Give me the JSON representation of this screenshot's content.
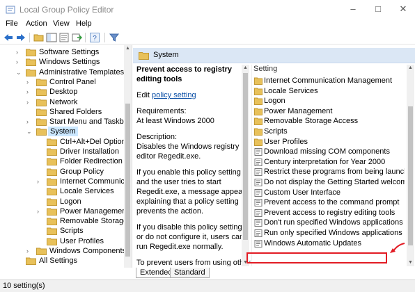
{
  "window": {
    "title": "Local Group Policy Editor"
  },
  "menu": [
    "File",
    "Action",
    "View",
    "Help"
  ],
  "tree": {
    "items": [
      {
        "label": "Software Settings",
        "expander": ">"
      },
      {
        "label": "Windows Settings",
        "expander": ">"
      },
      {
        "label": "Administrative Templates",
        "expander": "v"
      },
      {
        "label": "Control Panel",
        "expander": ">"
      },
      {
        "label": "Desktop",
        "expander": ">"
      },
      {
        "label": "Network",
        "expander": ">"
      },
      {
        "label": "Shared Folders",
        "expander": ""
      },
      {
        "label": "Start Menu and Taskbar",
        "expander": ">"
      },
      {
        "label": "System",
        "expander": "v",
        "selected": true
      },
      {
        "label": "Ctrl+Alt+Del Options",
        "expander": ""
      },
      {
        "label": "Driver Installation",
        "expander": ""
      },
      {
        "label": "Folder Redirection",
        "expander": ""
      },
      {
        "label": "Group Policy",
        "expander": ""
      },
      {
        "label": "Internet Communicat",
        "expander": ">"
      },
      {
        "label": "Locale Services",
        "expander": ""
      },
      {
        "label": "Logon",
        "expander": ""
      },
      {
        "label": "Power Management",
        "expander": ">"
      },
      {
        "label": "Removable Storage A",
        "expander": ""
      },
      {
        "label": "Scripts",
        "expander": ""
      },
      {
        "label": "User Profiles",
        "expander": ""
      },
      {
        "label": "Windows Components",
        "expander": ">"
      },
      {
        "label": "All Settings",
        "expander": ""
      }
    ]
  },
  "details": {
    "header": "System",
    "title": "Prevent access to registry editing tools",
    "edit_prefix": "Edit ",
    "edit_link": "policy setting",
    "requirements_label": "Requirements:",
    "requirements": "At least Windows 2000",
    "description_label": "Description:",
    "description": "Disables the Windows registry editor Regedit.exe.",
    "p_enable": "If you enable this policy setting and the user tries to start Regedit.exe, a message appears explaining that a policy setting prevents the action.",
    "p_disable": "If you disable this policy setting or do not configure it, users can run Regedit.exe normally.",
    "p_prevent": "To prevent users from using other administrative tools, use the \"Run only specified Windows"
  },
  "list": {
    "column_header": "Setting",
    "rows": [
      {
        "label": "Internet Communication Management",
        "type": "folder"
      },
      {
        "label": "Locale Services",
        "type": "folder"
      },
      {
        "label": "Logon",
        "type": "folder"
      },
      {
        "label": "Power Management",
        "type": "folder"
      },
      {
        "label": "Removable Storage Access",
        "type": "folder"
      },
      {
        "label": "Scripts",
        "type": "folder"
      },
      {
        "label": "User Profiles",
        "type": "folder"
      },
      {
        "label": "Download missing COM components",
        "type": "policy"
      },
      {
        "label": "Century interpretation for Year 2000",
        "type": "policy"
      },
      {
        "label": "Restrict these programs from being launched fro",
        "type": "policy"
      },
      {
        "label": "Do not display the Getting Started welcome scree",
        "type": "policy"
      },
      {
        "label": "Custom User Interface",
        "type": "policy"
      },
      {
        "label": "Prevent access to the command prompt",
        "type": "policy"
      },
      {
        "label": "Prevent access to registry editing tools",
        "type": "policy",
        "selected": true
      },
      {
        "label": "Don't run specified Windows applications",
        "type": "policy"
      },
      {
        "label": "Run only specified Windows applications",
        "type": "policy"
      },
      {
        "label": "Windows Automatic Updates",
        "type": "policy"
      }
    ]
  },
  "tabs": [
    "Extended",
    "Standard"
  ],
  "status": "10 setting(s)",
  "colors": {
    "highlight": "#e21b24",
    "header": "#dbe7f5",
    "link": "#0b4fa6",
    "folder": "#e8c15a"
  }
}
